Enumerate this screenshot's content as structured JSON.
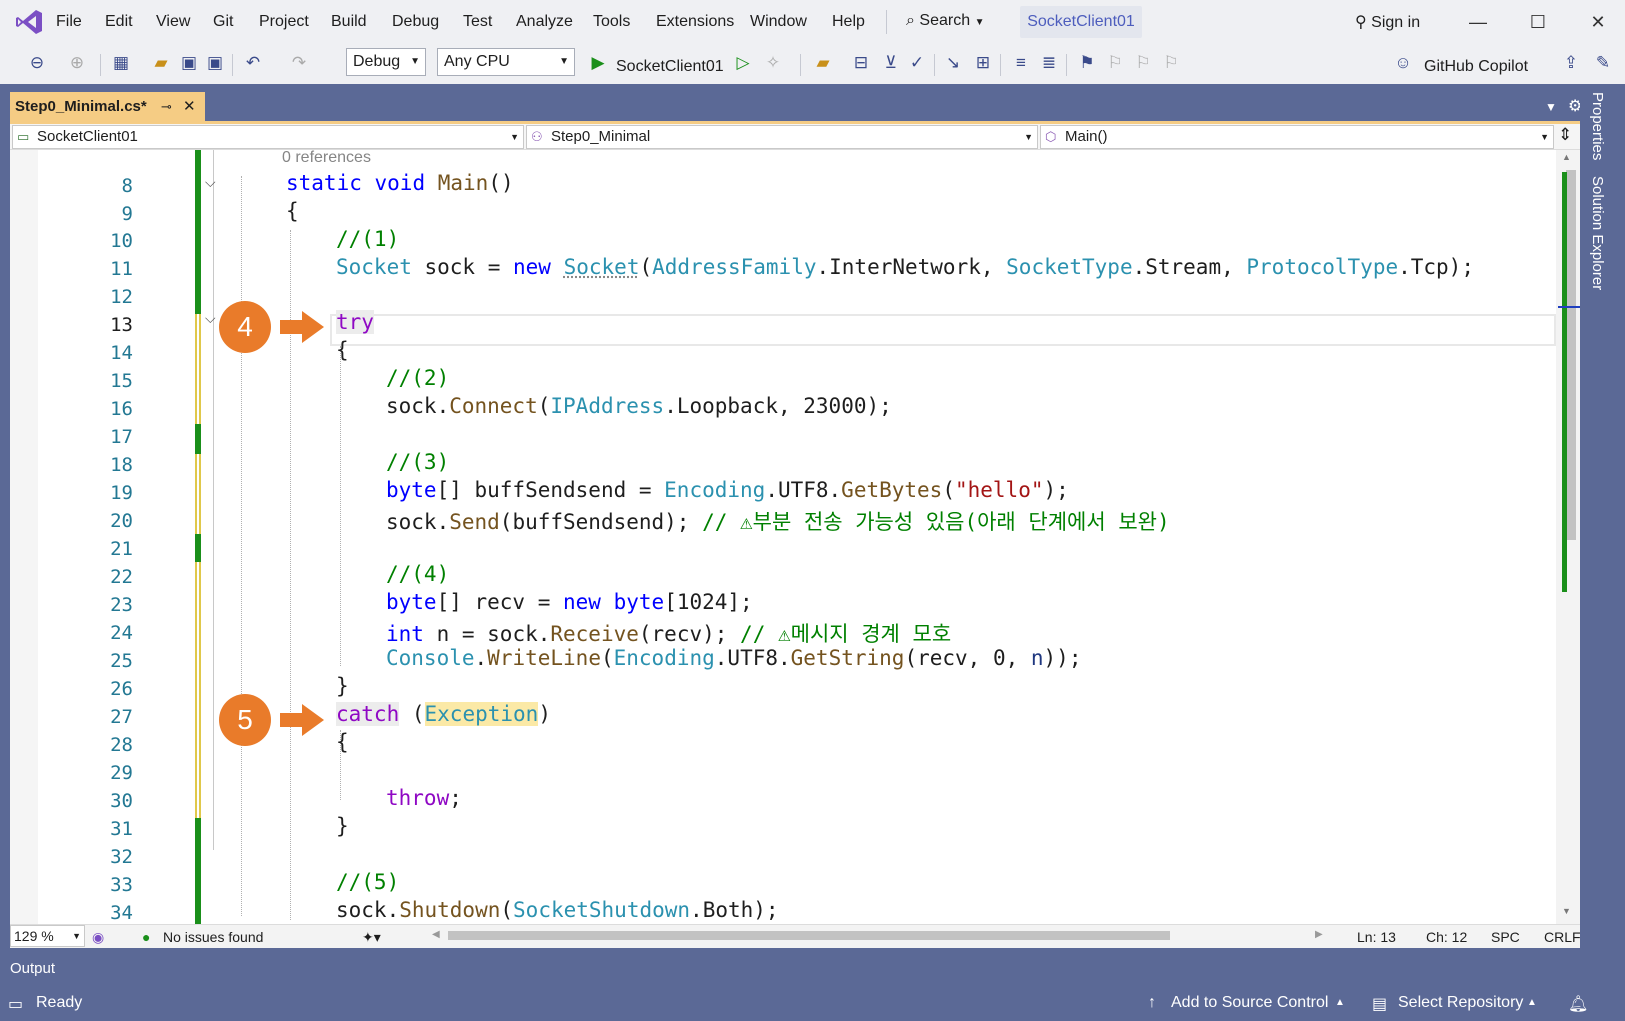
{
  "menu": {
    "items": [
      "File",
      "Edit",
      "View",
      "Git",
      "Project",
      "Build",
      "Debug",
      "Test",
      "Analyze",
      "Tools",
      "Extensions",
      "Window",
      "Help"
    ],
    "search_label": "Search",
    "solution_name": "SocketClient01",
    "sign_in": "Sign in"
  },
  "toolbar": {
    "config": "Debug",
    "platform": "Any CPU",
    "run_target": "SocketClient01",
    "copilot": "GitHub Copilot"
  },
  "tab": {
    "label": "Step0_Minimal.cs*"
  },
  "navbar": {
    "project": "SocketClient01",
    "type": "Step0_Minimal",
    "member": "Main()"
  },
  "sidebar": {
    "properties": "Properties",
    "solution_explorer": "Solution Explorer"
  },
  "editor": {
    "codelens": "0 references",
    "line_numbers": [
      "8",
      "9",
      "10",
      "11",
      "12",
      "13",
      "14",
      "15",
      "16",
      "17",
      "18",
      "19",
      "20",
      "21",
      "22",
      "23",
      "24",
      "25",
      "26",
      "27",
      "28",
      "29",
      "30",
      "31",
      "32",
      "33",
      "34"
    ],
    "callouts": [
      "4",
      "5"
    ],
    "code": {
      "l8_static": "static",
      "l8_void": "void",
      "l8_main": "Main",
      "l8_rest": "()",
      "l9": "{",
      "l10": "//(1)",
      "l11_t1": "Socket",
      "l11_a": " sock = ",
      "l11_new": "new",
      "l11_sp": " ",
      "l11_t2": "Socket",
      "l11_b": "(",
      "l11_t3": "AddressFamily",
      "l11_c": ".InterNetwork, ",
      "l11_t4": "SocketType",
      "l11_d": ".Stream, ",
      "l11_t5": "ProtocolType",
      "l11_e": ".Tcp);",
      "l13": "try",
      "l14": "{",
      "l15": "//(2)",
      "l16_a": "sock.",
      "l16_m": "Connect",
      "l16_b": "(",
      "l16_t": "IPAddress",
      "l16_c": ".Loopback, 23000);",
      "l18": "//(3)",
      "l19_kw": "byte",
      "l19_a": "[] buffSendsend = ",
      "l19_t": "Encoding",
      "l19_b": ".UTF8.",
      "l19_m": "GetBytes",
      "l19_c": "(",
      "l19_s": "\"hello\"",
      "l19_d": ");",
      "l20_a": "sock.",
      "l20_m": "Send",
      "l20_b": "(buffSendsend); ",
      "l20_cmt": "// ⚠부분 전송 가능성 있음(아래 단계에서 보완)",
      "l22": "//(4)",
      "l23_kw": "byte",
      "l23_a": "[] recv = ",
      "l23_new": "new",
      "l23_sp": " ",
      "l23_kw2": "byte",
      "l23_b": "[1024];",
      "l24_kw": "int",
      "l24_a": " n = sock.",
      "l24_m": "Receive",
      "l24_b": "(recv); ",
      "l24_cmt": "// ⚠메시지 경계 모호",
      "l25_t": "Console",
      "l25_a": ".",
      "l25_m": "WriteLine",
      "l25_b": "(",
      "l25_t2": "Encoding",
      "l25_c": ".UTF8.",
      "l25_m2": "GetString",
      "l25_d": "(recv, 0, ",
      "l25_p": "n",
      "l25_e": "));",
      "l26": "}",
      "l27_kw": "catch",
      "l27_a": " (",
      "l27_t": "Exception",
      "l27_b": ")",
      "l28": "{",
      "l30": "throw",
      "l30_b": ";",
      "l31": "}",
      "l33": "//(5)",
      "l34_a": "sock.",
      "l34_m": "Shutdown",
      "l34_b": "(",
      "l34_t": "SocketShutdown",
      "l34_c": ".Both);"
    }
  },
  "editor_status": {
    "zoom": "129 %",
    "issues": "No issues found",
    "ln": "Ln: 13",
    "ch": "Ch: 12",
    "spc": "SPC",
    "eol": "CRLF"
  },
  "output_label": "Output",
  "statusbar": {
    "ready": "Ready",
    "source_control": "Add to Source Control",
    "repository": "Select Repository"
  },
  "colors": {
    "accent": "#5b6996",
    "tab_active": "#f5cc84",
    "callout": "#e97b2a",
    "change_saved": "#1a8f1a"
  }
}
